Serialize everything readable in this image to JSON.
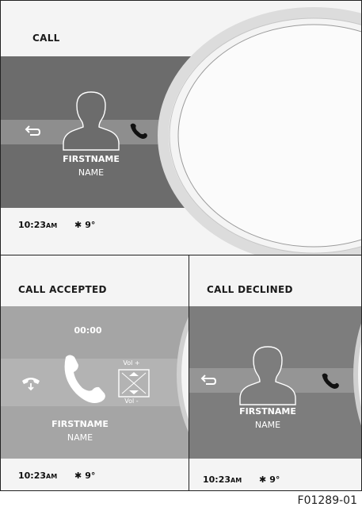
{
  "screens": {
    "call": {
      "title": "CALL",
      "firstname": "FIRSTNAME",
      "name": "NAME",
      "status": {
        "time": "10:23",
        "ampm": "AM",
        "bluetooth_icon": "bluetooth-icon",
        "temperature": "9°"
      }
    },
    "call_accepted": {
      "title": "CALL ACCEPTED",
      "timer": "00:00",
      "firstname": "FIRSTNAME",
      "name": "NAME",
      "vol_plus": "Vol +",
      "vol_minus": "Vol -",
      "status": {
        "time": "10:23",
        "ampm": "AM",
        "bluetooth_icon": "bluetooth-icon",
        "temperature": "9°"
      }
    },
    "call_declined": {
      "title": "CALL DECLINED",
      "firstname": "FIRSTNAME",
      "name": "NAME",
      "status": {
        "time": "10:23",
        "ampm": "AM",
        "bluetooth_icon": "bluetooth-icon",
        "temperature": "9°"
      }
    }
  },
  "figure_code": "F01289-01",
  "colors": {
    "dark_band": "#6c6c6c",
    "light_band": "#a5a5a5",
    "background": "#f4f4f4"
  }
}
